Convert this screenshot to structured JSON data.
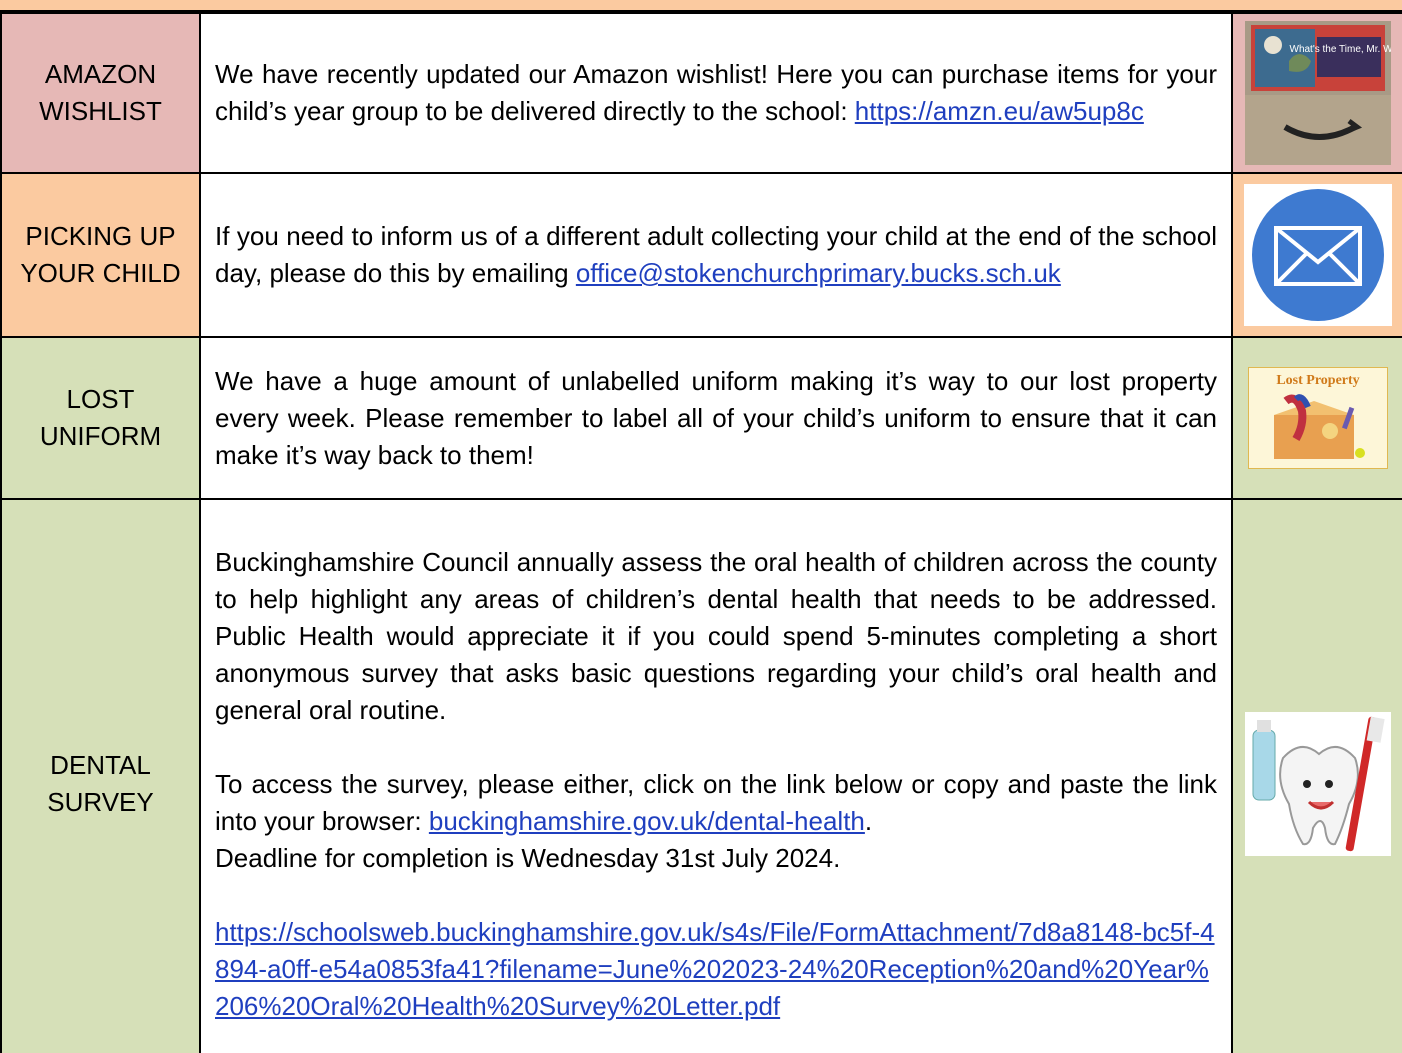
{
  "rows": [
    {
      "label": "AMAZON WISHLIST",
      "text": "We have recently updated our Amazon wishlist! Here you can purchase items for your child’s year group to be delivered directly to the school: ",
      "link": "https://amzn.eu/aw5up8c",
      "image": {
        "icon": "amazon-wishlist-book-image",
        "caption": "What's the Time, Mr. Wolf?"
      }
    },
    {
      "label": "PICKING UP YOUR CHILD",
      "text": "If you need to inform us of a different adult collecting your child at the end of the school day, please do this by emailing ",
      "link": "office@stokenchurchprimary.bucks.sch.uk",
      "image": {
        "icon": "envelope-icon"
      }
    },
    {
      "label": "LOST UNIFORM",
      "text": "We have a huge amount of unlabelled uniform making it’s way to our lost property every week. Please remember to label all of your child’s uniform to ensure that it can make it’s way back to them!",
      "image": {
        "icon": "lost-property-box-image",
        "caption": "Lost Property"
      }
    },
    {
      "label": "DENTAL SURVEY",
      "paragraph1": "Buckinghamshire Council annually assess the oral health of children across the county to help highlight any areas of children’s dental health that needs to be addressed. Public Health would appreciate it if you could spend 5-minutes completing a short anonymous survey that asks basic questions regarding your child’s oral health and general oral routine.",
      "paragraph2_before": "To access the survey, please either, click on the link below or copy and paste the link into your browser: ",
      "paragraph2_link": "buckinghamshire.gov.uk/dental-health",
      "paragraph2_after": ".",
      "paragraph2_deadline": "Deadline for completion is Wednesday 31st July 2024.",
      "paragraph3_link": "https://schoolsweb.buckinghamshire.gov.uk/s4s/File/FormAttachment/7d8a8148-bc5f-4894-a0ff-e54a0853fa41?filename=June%202023-24%20Reception%20and%20Year%206%20Oral%20Health%20Survey%20Letter.pdf",
      "image": {
        "icon": "tooth-toothbrush-image"
      }
    }
  ],
  "colors": {
    "amazon_bg": "#e6b8b6",
    "pickup_bg": "#fbcaa0",
    "green_bg": "#d6e0b8",
    "link": "#1f3fbf"
  }
}
